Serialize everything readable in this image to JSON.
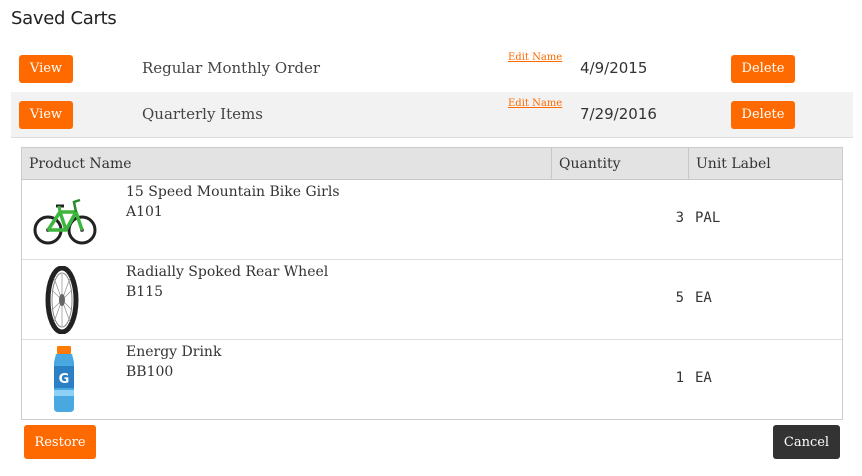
{
  "page": {
    "title": "Saved Carts"
  },
  "carts": [
    {
      "view_label": "View",
      "name": "Regular Monthly Order",
      "edit_label": "Edit Name",
      "date": "4/9/2015",
      "delete_label": "Delete"
    },
    {
      "view_label": "View",
      "name": "Quarterly Items",
      "edit_label": "Edit Name",
      "date": "7/29/2016",
      "delete_label": "Delete"
    }
  ],
  "product_table": {
    "columns": [
      "Product Name",
      "Quantity",
      "Unit Label"
    ],
    "rows": [
      {
        "image": "bike-image",
        "name": "15 Speed Mountain Bike Girls",
        "sku": "A101",
        "quantity": "3",
        "unit": "PAL"
      },
      {
        "image": "wheel-image",
        "name": "Radially Spoked Rear Wheel",
        "sku": "B115",
        "quantity": "5",
        "unit": "EA"
      },
      {
        "image": "drink-bottle-image",
        "name": "Energy Drink",
        "sku": "BB100",
        "quantity": "1",
        "unit": "EA"
      }
    ]
  },
  "actions": {
    "restore_label": "Restore",
    "cancel_label": "Cancel"
  },
  "colors": {
    "accent": "#ff6a00",
    "dark_button": "#333333",
    "header_bg": "#e3e3e3",
    "selected_row": "#f2f2f2"
  }
}
